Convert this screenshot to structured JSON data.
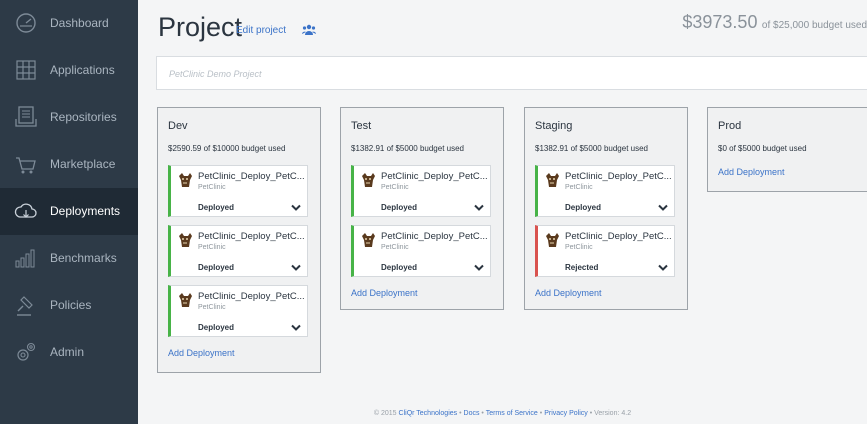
{
  "sidebar": {
    "items": [
      {
        "label": "Dashboard",
        "icon": "dashboard-icon"
      },
      {
        "label": "Applications",
        "icon": "applications-icon"
      },
      {
        "label": "Repositories",
        "icon": "repositories-icon"
      },
      {
        "label": "Marketplace",
        "icon": "marketplace-icon"
      },
      {
        "label": "Deployments",
        "icon": "deployments-icon",
        "active": true
      },
      {
        "label": "Benchmarks",
        "icon": "benchmarks-icon"
      },
      {
        "label": "Policies",
        "icon": "policies-icon"
      },
      {
        "label": "Admin",
        "icon": "admin-icon"
      }
    ]
  },
  "header": {
    "title": "Project",
    "edit_label": "Edit project",
    "budget_amount": "$3973.50",
    "budget_text": "of $25,000 budget used"
  },
  "description": "PetClinic Demo Project",
  "columns": [
    {
      "title": "Dev",
      "budget": "$2590.59 of $10000 budget used",
      "cards": [
        {
          "title": "PetClinic_Deploy_PetC...",
          "app": "PetClinic",
          "status": "Deployed"
        },
        {
          "title": "PetClinic_Deploy_PetC...",
          "app": "PetClinic",
          "status": "Deployed"
        },
        {
          "title": "PetClinic_Deploy_PetC...",
          "app": "PetClinic",
          "status": "Deployed"
        }
      ],
      "add_label": "Add Deployment"
    },
    {
      "title": "Test",
      "budget": "$1382.91 of $5000 budget used",
      "cards": [
        {
          "title": "PetClinic_Deploy_PetC...",
          "app": "PetClinic",
          "status": "Deployed"
        },
        {
          "title": "PetClinic_Deploy_PetC...",
          "app": "PetClinic",
          "status": "Deployed"
        }
      ],
      "add_label": "Add Deployment"
    },
    {
      "title": "Staging",
      "budget": "$1382.91 of $5000 budget used",
      "cards": [
        {
          "title": "PetClinic_Deploy_PetC...",
          "app": "PetClinic",
          "status": "Deployed"
        },
        {
          "title": "PetClinic_Deploy_PetC...",
          "app": "PetClinic",
          "status": "Rejected"
        }
      ],
      "add_label": "Add Deployment"
    },
    {
      "title": "Prod",
      "budget": "$0 of $5000 budget used",
      "cards": [],
      "add_label": "Add Deployment"
    }
  ],
  "footer": {
    "copyright": "© 2015",
    "company": "CliQr Technologies",
    "sep": "•",
    "docs": "Docs",
    "terms": "Terms of Service",
    "privacy": "Privacy Policy",
    "version": "Version: 4.2"
  },
  "colors": {
    "sidebar_bg": "#2d3a47",
    "sidebar_active_bg": "#1f2a35",
    "link": "#3b73c8",
    "deployed": "#47b347",
    "rejected": "#d9534f"
  }
}
